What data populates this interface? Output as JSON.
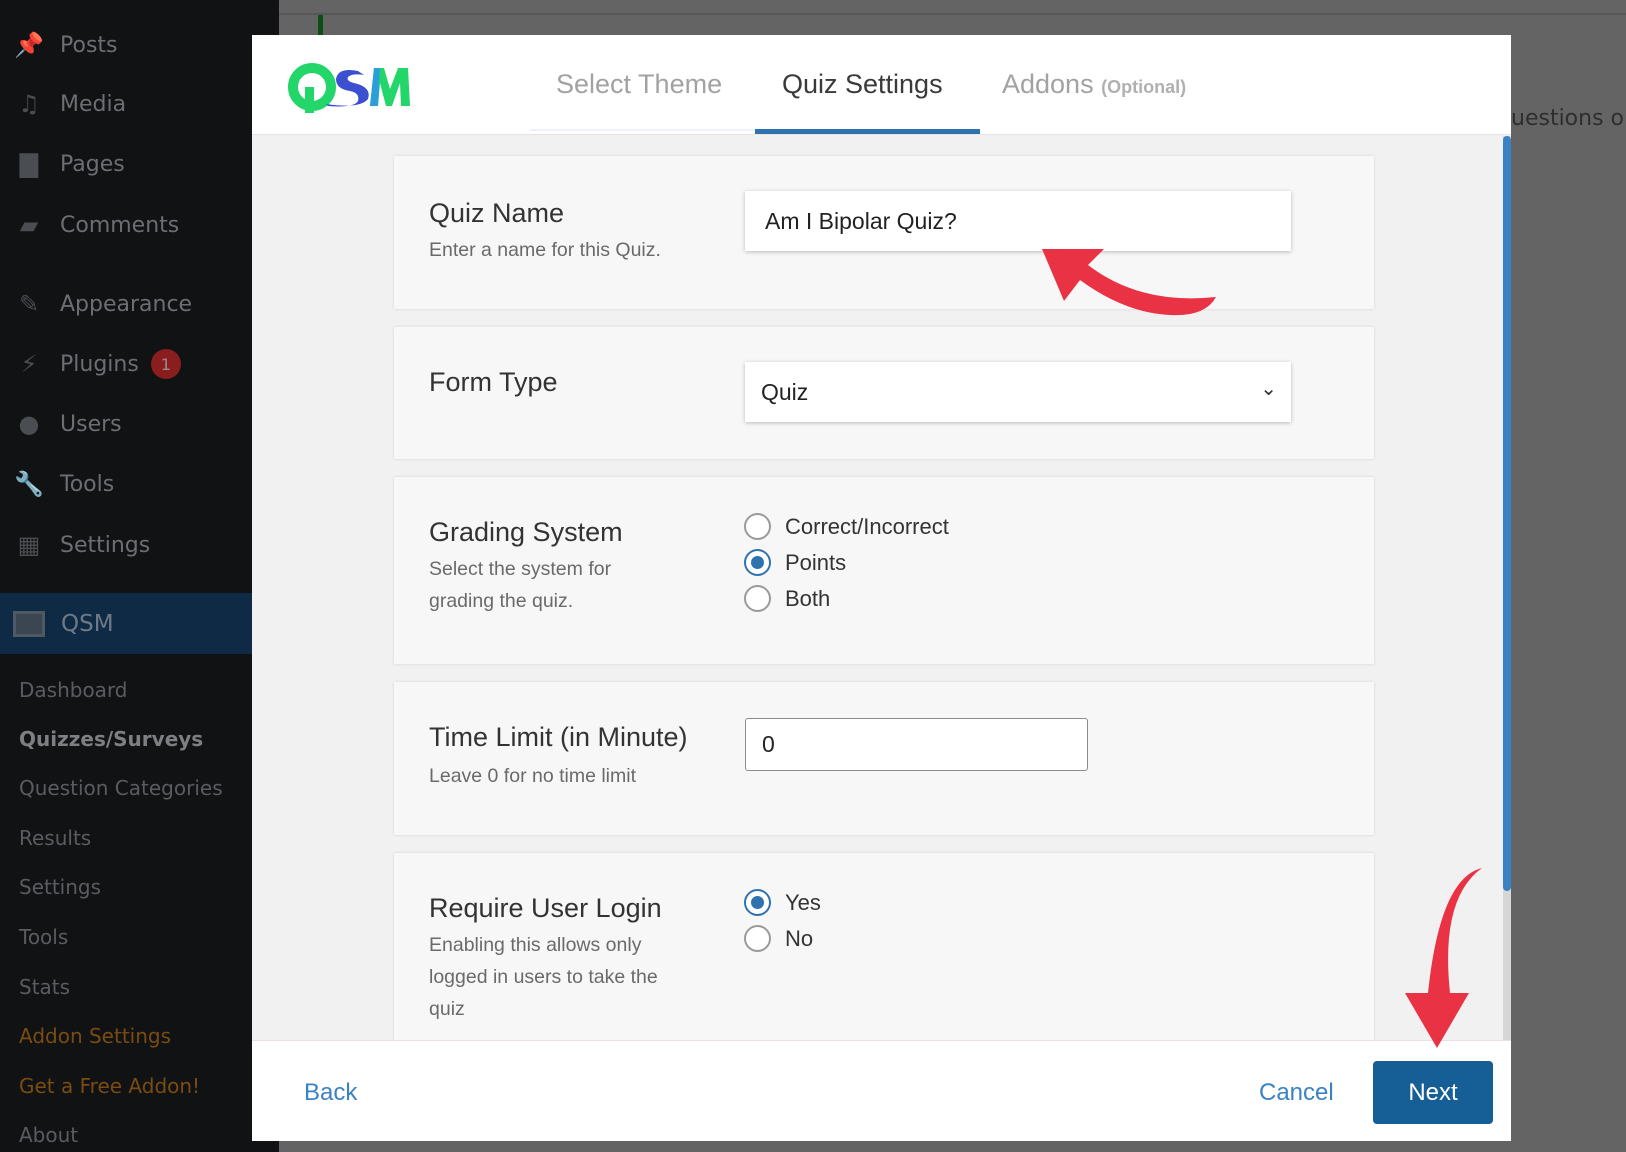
{
  "sidebar": {
    "items": [
      {
        "label": "Posts",
        "icon": "pin-icon"
      },
      {
        "label": "Media",
        "icon": "media-icon"
      },
      {
        "label": "Pages",
        "icon": "pages-icon"
      },
      {
        "label": "Comments",
        "icon": "comment-icon"
      },
      {
        "label": "Appearance",
        "icon": "brush-icon"
      },
      {
        "label": "Plugins",
        "icon": "plugin-icon",
        "badge": "1"
      },
      {
        "label": "Users",
        "icon": "user-icon"
      },
      {
        "label": "Tools",
        "icon": "wrench-icon"
      },
      {
        "label": "Settings",
        "icon": "settings-icon"
      }
    ],
    "active": {
      "label": "QSM",
      "icon": "qsm-icon"
    },
    "submenu": [
      "Dashboard",
      "Quizzes/Surveys",
      "Question Categories",
      "Results",
      "Settings",
      "Tools",
      "Stats",
      "Addon Settings",
      "Get a Free Addon!",
      "About"
    ]
  },
  "background": {
    "text": "uestions or u"
  },
  "modal": {
    "logo": "QSM",
    "tabs": [
      {
        "label": "Select Theme"
      },
      {
        "label": "Quiz Settings",
        "active": true
      },
      {
        "label": "Addons",
        "suffix": "(Optional)"
      }
    ],
    "fields": {
      "quiz_name": {
        "label": "Quiz Name",
        "description": "Enter a name for this Quiz.",
        "value": "Am I Bipolar Quiz?"
      },
      "form_type": {
        "label": "Form Type",
        "value": "Quiz"
      },
      "grading": {
        "label": "Grading System",
        "description": "Select the system for grading the quiz.",
        "options": [
          "Correct/Incorrect",
          "Points",
          "Both"
        ],
        "selected": "Points"
      },
      "time_limit": {
        "label": "Time Limit (in Minute)",
        "description": "Leave 0 for no time limit",
        "value": "0"
      },
      "login": {
        "label": "Require User Login",
        "description": "Enabling this allows only logged in users to take the quiz",
        "options": [
          "Yes",
          "No"
        ],
        "selected": "Yes"
      }
    },
    "footer": {
      "back": "Back",
      "cancel": "Cancel",
      "next": "Next"
    }
  },
  "colors": {
    "accent": "#2f72b0",
    "next_button": "#155e96",
    "annotation_arrow": "#e93345",
    "logo_green": "#22d66a",
    "logo_blue": "#3b4fd0"
  }
}
